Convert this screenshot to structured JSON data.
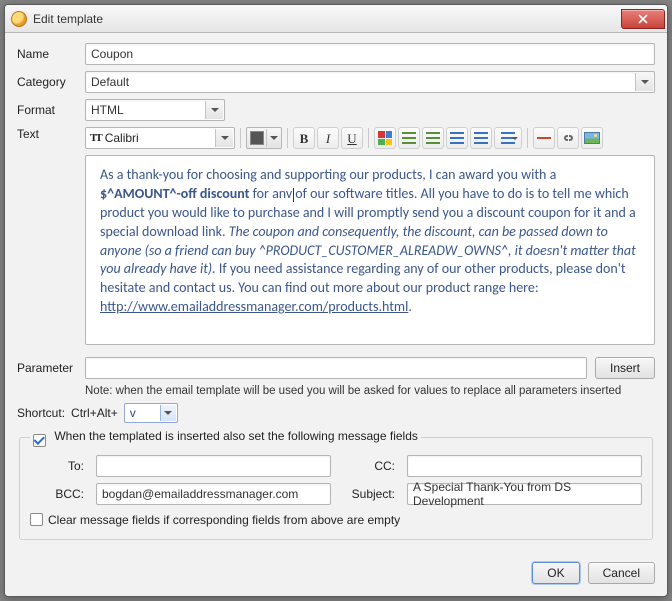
{
  "window": {
    "title": "Edit template"
  },
  "labels": {
    "name": "Name",
    "category": "Category",
    "format": "Format",
    "text": "Text",
    "parameter": "Parameter",
    "shortcut": "Shortcut:",
    "shortcut_prefix": "Ctrl+Alt+"
  },
  "fields": {
    "name": "Coupon",
    "category": "Default",
    "format": "HTML",
    "font": "Calibri",
    "parameter": "",
    "shortcut_key": "v"
  },
  "buttons": {
    "insert": "Insert",
    "ok": "OK",
    "cancel": "Cancel"
  },
  "note": "Note: when the email template will be used you will be asked for values to replace all parameters inserted",
  "set_fields_check_label": "When the templated is inserted also set the following message fields",
  "set_fields_checked": true,
  "clear_fields_check_label": "Clear message fields if corresponding fields from above are empty",
  "clear_fields_checked": false,
  "msg": {
    "to_label": "To:",
    "cc_label": "CC:",
    "bcc_label": "BCC:",
    "subject_label": "Subject:",
    "to": "",
    "cc": "",
    "bcc": "bogdan@emailaddressmanager.com",
    "subject": "A Special Thank-You from DS Development"
  },
  "body": {
    "t1": "As a thank-you for choosing and supporting our products, I can award you with a ",
    "bold1": "$^AMOUNT^-off discount",
    "t2": " for any of our software titles. All you have to do is to tell me which product you would like to purchase and I will promptly send you a discount coupon for it and a special download link. ",
    "ital1": "The coupon and consequently, the discount, can be passed down to anyone (so a friend can buy ^PRODUCT_CUSTOMER_ALREADW_OWNS^, it doesn't matter that you already have it).",
    "t3": " If you need assistance regarding any of our other products, please don't hesitate and contact us. You can find out more about our product range here: ",
    "link": "http://www.emailaddressmanager.com/products.html",
    "t4": "."
  }
}
